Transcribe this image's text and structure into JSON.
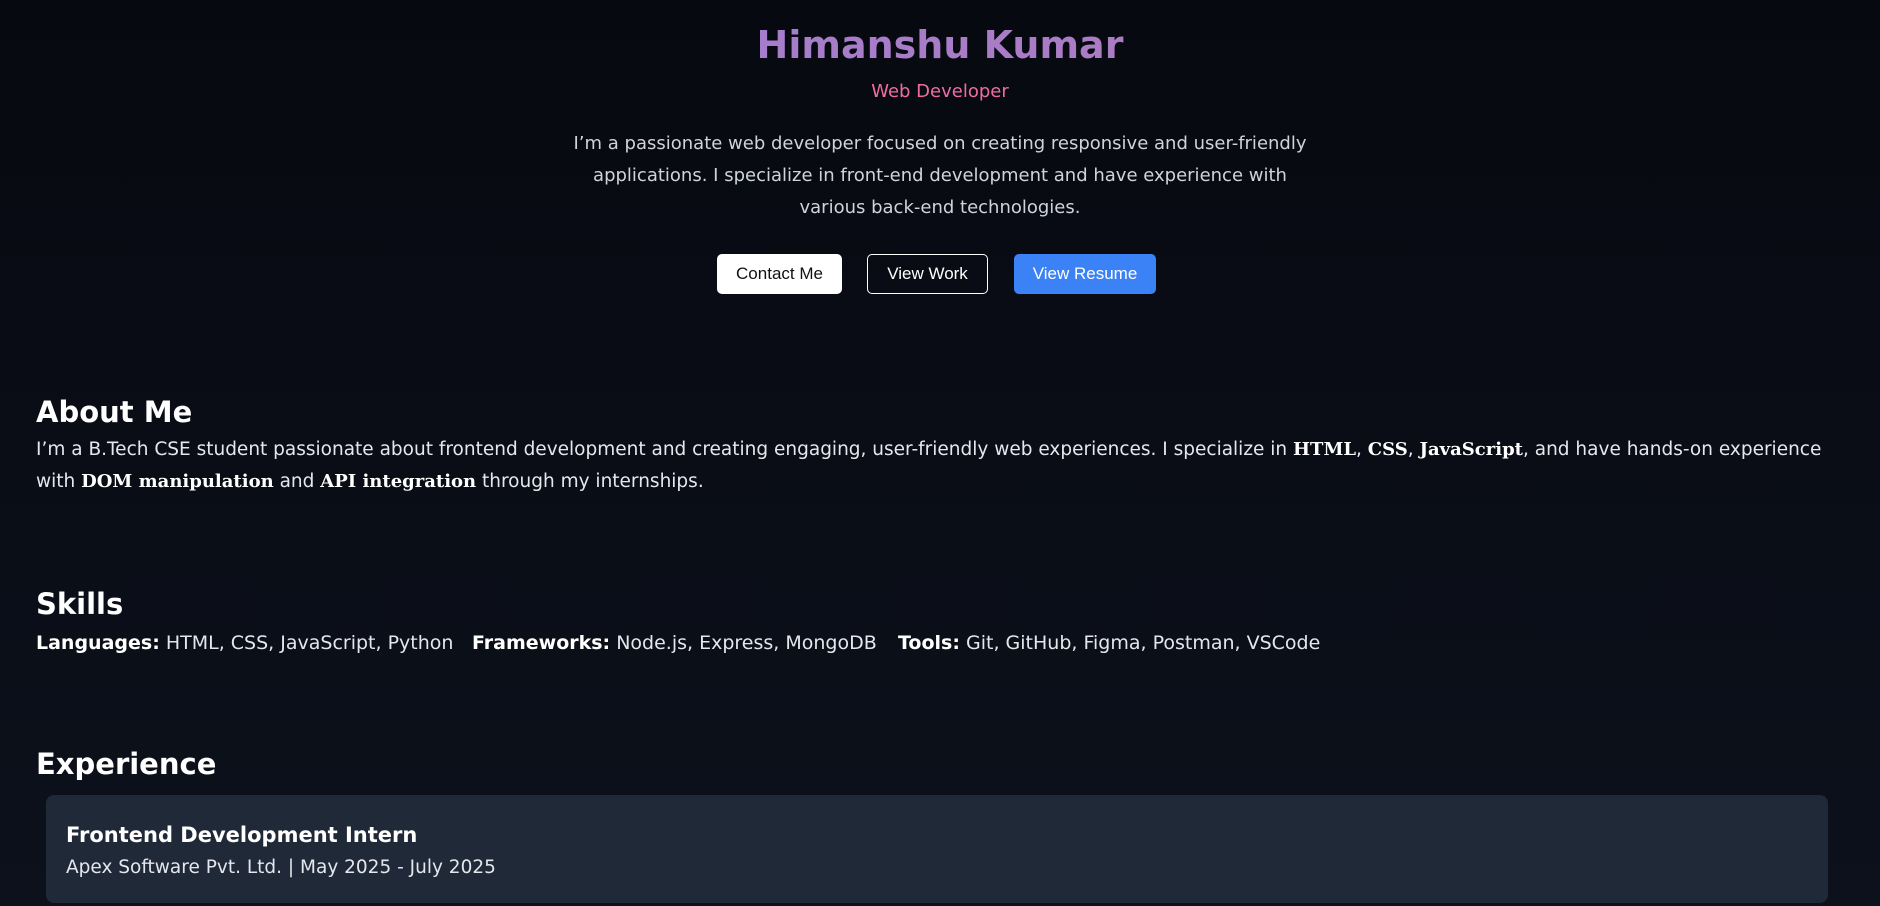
{
  "hero": {
    "name": "Himanshu Kumar",
    "role": "Web Developer",
    "bio": "I’m a passionate web developer focused on creating responsive and user-friendly applications. I specialize in front-end development and have experience with various back-end technologies.",
    "buttons": {
      "contact": "Contact Me",
      "work": "View Work",
      "resume": "View Resume"
    }
  },
  "about": {
    "title": "About Me",
    "text_1": "I’m a B.Tech CSE student passionate about frontend development and creating engaging, user-friendly web experiences. I specialize in ",
    "hl_1": "HTML",
    "sep_1": ", ",
    "hl_2": "CSS",
    "sep_2": ", ",
    "hl_3": "JavaScript",
    "text_2": ", and have hands-on experience with ",
    "hl_4": "DOM manipulation",
    "text_3": " and ",
    "hl_5": "API integration",
    "text_4": " through my internships."
  },
  "skills": {
    "title": "Skills",
    "groups": [
      {
        "label": "Languages:",
        "value": " HTML, CSS, JavaScript, Python"
      },
      {
        "label": "Frameworks:",
        "value": " Node.js, Express, MongoDB"
      },
      {
        "label": "Tools:",
        "value": " Git, GitHub, Figma, Postman, VSCode"
      }
    ]
  },
  "experience": {
    "title": "Experience",
    "items": [
      {
        "role": "Frontend Development Intern",
        "meta": "Apex Software Pvt. Ltd. | May 2025 - July 2025"
      }
    ]
  },
  "colors": {
    "name_gradient_start": "#9b7fd6",
    "name_gradient_end": "#b67ab8",
    "role": "#f06ba6",
    "resume_button": "#3b82f6",
    "card_background": "#1f2937"
  }
}
